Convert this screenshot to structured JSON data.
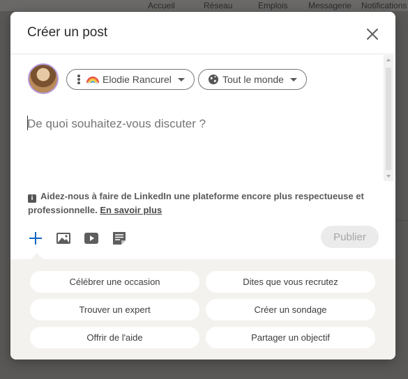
{
  "background": {
    "nav": [
      "Accueil",
      "Réseau",
      "Emplois",
      "Messagerie",
      "Notifications"
    ]
  },
  "modal": {
    "title": "Créer un post",
    "author": {
      "name": "Elodie Rancurel",
      "badge_icon": "rainbow-icon"
    },
    "audience": "Tout le monde",
    "composer_placeholder": "De quoi souhaitez-vous discuter ?",
    "notice": {
      "text": "Aidez-nous à faire de LinkedIn une plateforme encore plus respectueuse et professionnelle.",
      "link": "En savoir plus"
    },
    "toolbar": {
      "icons": [
        "plus-icon",
        "image-icon",
        "video-icon",
        "document-icon"
      ],
      "publish_label": "Publier"
    },
    "suggestions": [
      "Célébrer une occasion",
      "Dites que vous recrutez",
      "Trouver un expert",
      "Créer un sondage",
      "Offrir de l'aide",
      "Partager un objectif"
    ],
    "colors": {
      "accent": "#0a66c2",
      "publish_disabled_bg": "#ebebeb",
      "suggest_bg": "#f4f2ee"
    }
  }
}
